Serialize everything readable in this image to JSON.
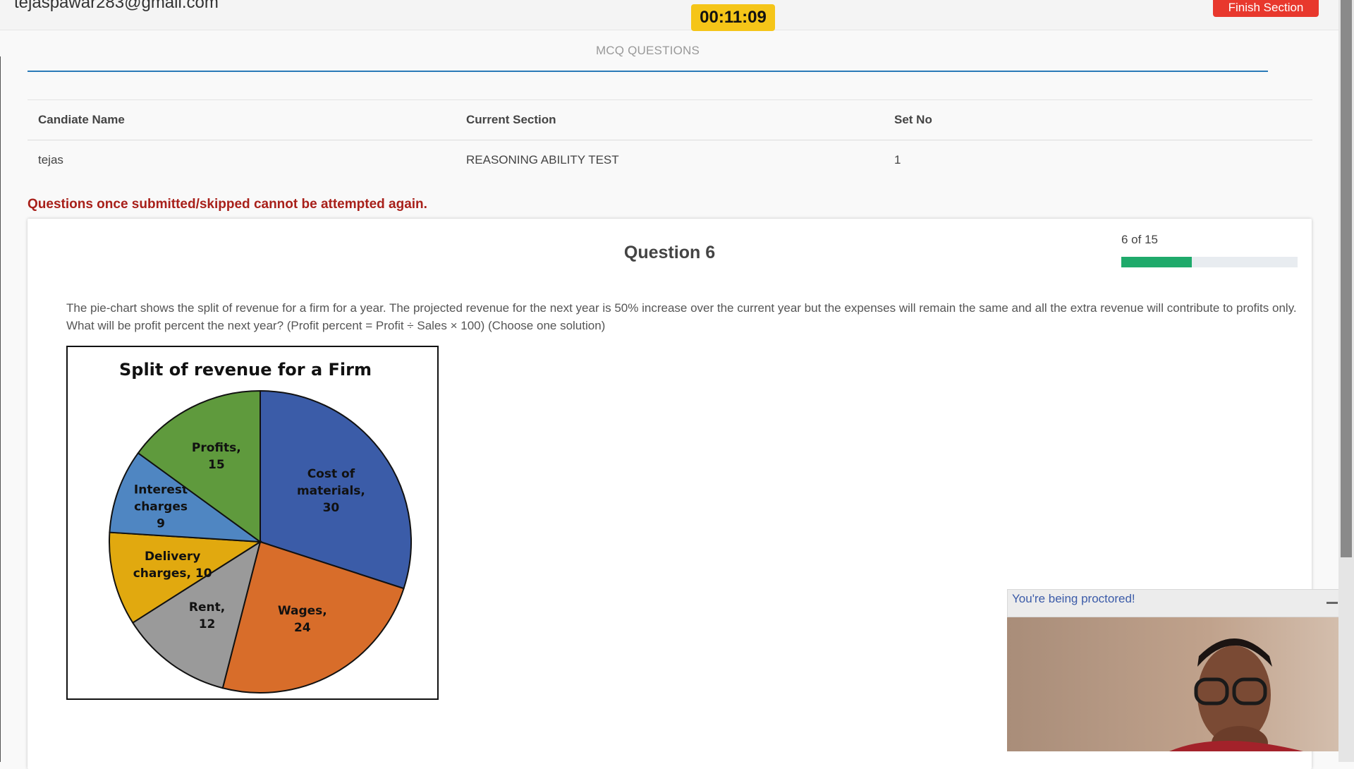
{
  "header": {
    "email": "tejaspawar283@gmail.com",
    "timer": "00:11:09",
    "finish_label": "Finish Section"
  },
  "section_title": "MCQ QUESTIONS",
  "info_table": {
    "headers": [
      "Candiate Name",
      "Current Section",
      "Set No"
    ],
    "values": [
      "tejas",
      "REASONING ABILITY TEST",
      "1"
    ]
  },
  "warning": "Questions once submitted/skipped cannot be attempted again.",
  "question": {
    "title": "Question 6",
    "counter": "6 of 15",
    "progress_fraction": 0.4,
    "text": "The pie-chart shows the split of revenue for a firm for a year. The projected revenue for the next year is 50% increase over the current year but the expenses will remain the same and all the extra revenue will contribute to profits only. What will be profit percent the next year? (Profit percent = Profit ÷ Sales × 100) (Choose one solution)"
  },
  "chart_data": {
    "type": "pie",
    "title": "Split of revenue for a Firm",
    "slices": [
      {
        "label_lines": [
          "Cost of",
          "materials,",
          "30"
        ],
        "value": 30,
        "color": "#3b5ca8"
      },
      {
        "label_lines": [
          "Wages,",
          "24"
        ],
        "value": 24,
        "color": "#d86d2a"
      },
      {
        "label_lines": [
          "Rent,",
          "12"
        ],
        "value": 12,
        "color": "#9a9a9a"
      },
      {
        "label_lines": [
          "Delivery",
          "charges, 10"
        ],
        "value": 10,
        "color": "#e1a90f"
      },
      {
        "label_lines": [
          "Interest",
          "charges",
          "9"
        ],
        "value": 9,
        "color": "#4f86c2"
      },
      {
        "label_lines": [
          "Profits,",
          "15"
        ],
        "value": 15,
        "color": "#5f9a3d"
      }
    ]
  },
  "proctor": {
    "label": "You're being proctored!"
  }
}
